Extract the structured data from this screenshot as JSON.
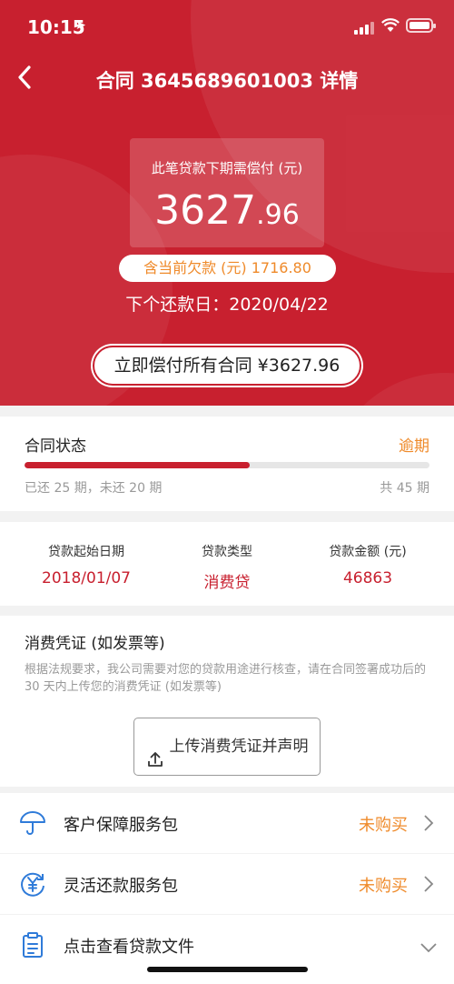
{
  "status_bar": {
    "time": "10:15"
  },
  "nav": {
    "title": "合同 3645689601003 详情"
  },
  "hero": {
    "card_label": "此笔贷款下期需偿付 (元)",
    "amount_int": "3627",
    "amount_dec": ".96",
    "arrears": "含当前欠款 (元) 1716.80",
    "next_date": "下个还款日：2020/04/22",
    "pay_all": "立即偿付所有合同 ¥3627.96"
  },
  "contract_status": {
    "title": "合同状态",
    "state": "逾期",
    "progress_fraction": 0.5556,
    "summary": "已还 25 期，未还 20 期",
    "total": "共 45 期"
  },
  "loan_info": [
    {
      "key": "贷款起始日期",
      "value": "2018/01/07"
    },
    {
      "key": "贷款类型",
      "value": "消费贷"
    },
    {
      "key": "贷款金额 (元)",
      "value": "46863"
    }
  ],
  "voucher": {
    "title": "消费凭证 (如发票等)",
    "desc": "根据法规要求，我公司需要对您的贷款用途进行核查，请在合同签署成功后的 30 天内上传您的消费凭证 (如发票等)",
    "upload_label": "上传消费凭证并声明"
  },
  "rows": [
    {
      "label": "客户保障服务包",
      "state": "未购买",
      "icon": "umbrella-icon"
    },
    {
      "label": "灵活还款服务包",
      "state": "未购买",
      "icon": "yuan-cycle-icon"
    },
    {
      "label": "点击查看贷款文件",
      "state": "",
      "icon": "clipboard-icon"
    }
  ],
  "colors": {
    "brand_red": "#c8202f",
    "accent_orange": "#ef8a2a",
    "icon_blue": "#2f7bd9"
  }
}
